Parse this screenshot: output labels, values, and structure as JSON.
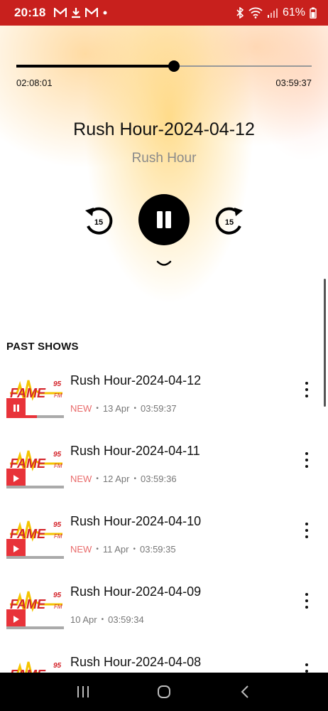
{
  "status_bar": {
    "time": "20:18",
    "battery": "61%",
    "bg_color": "#c8201d",
    "notification_icons": [
      "gmail-icon",
      "download-icon",
      "gmail-icon",
      "dot-icon"
    ],
    "system_icons": [
      "bluetooth-icon",
      "wifi-icon",
      "signal-icon",
      "battery-icon"
    ]
  },
  "player": {
    "elapsed": "02:08:01",
    "total": "03:59:37",
    "progress": 0.534,
    "title": "Rush Hour-2024-04-12",
    "artist": "Rush Hour",
    "rewind_seconds": "15",
    "forward_seconds": "15",
    "state": "playing"
  },
  "past_shows": {
    "title": "PAST SHOWS",
    "new_label": "NEW",
    "logo_text": "FAME",
    "logo_number": "95",
    "logo_suffix": "FM",
    "items": [
      {
        "title": "Rush Hour-2024-04-12",
        "is_new": true,
        "date": "13 Apr",
        "duration": "03:59:37",
        "progress": 0.53,
        "playing": true
      },
      {
        "title": "Rush Hour-2024-04-11",
        "is_new": true,
        "date": "12 Apr",
        "duration": "03:59:36",
        "progress": 0.0,
        "playing": false
      },
      {
        "title": "Rush Hour-2024-04-10",
        "is_new": true,
        "date": "11 Apr",
        "duration": "03:59:35",
        "progress": 0.0,
        "playing": false
      },
      {
        "title": "Rush Hour-2024-04-09",
        "is_new": false,
        "date": "10 Apr",
        "duration": "03:59:34",
        "progress": 0.0,
        "playing": false
      },
      {
        "title": "Rush Hour-2024-04-08",
        "is_new": false,
        "date": "",
        "duration": "",
        "progress": 0.0,
        "playing": false
      }
    ]
  },
  "colors": {
    "accent": "#e8333a",
    "new_text": "#e96b6b",
    "logo_yellow": "#f5c400"
  }
}
